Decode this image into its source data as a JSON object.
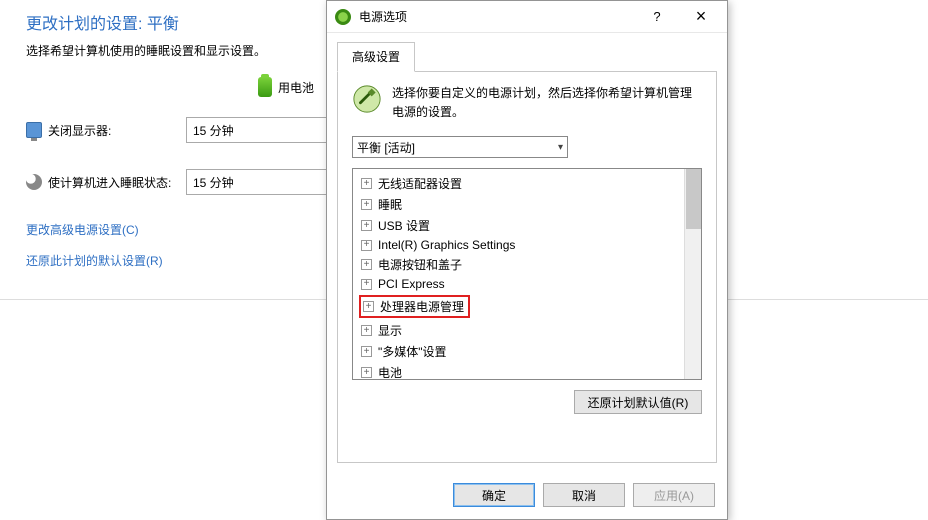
{
  "bg": {
    "title": "更改计划的设置: 平衡",
    "subtitle": "选择希望计算机使用的睡眠设置和显示设置。",
    "battery_label": "用电池",
    "display_off_label": "关闭显示器:",
    "display_off_value": "15 分钟",
    "sleep_label": "使计算机进入睡眠状态:",
    "sleep_value": "15 分钟",
    "link_advanced": "更改高级电源设置(C)",
    "link_restore": "还原此计划的默认设置(R)"
  },
  "dialog": {
    "title": "电源选项",
    "help_symbol": "?",
    "close_symbol": "×",
    "tab_label": "高级设置",
    "description": "选择你要自定义的电源计划，然后选择你希望计算机管理电源的设置。",
    "plan_selected": "平衡 [活动]",
    "tree": [
      {
        "label": "无线适配器设置",
        "highlight": false
      },
      {
        "label": "睡眠",
        "highlight": false
      },
      {
        "label": "USB 设置",
        "highlight": false
      },
      {
        "label": "Intel(R) Graphics Settings",
        "highlight": false
      },
      {
        "label": "电源按钮和盖子",
        "highlight": false
      },
      {
        "label": "PCI Express",
        "highlight": false
      },
      {
        "label": "处理器电源管理",
        "highlight": true
      },
      {
        "label": "显示",
        "highlight": false
      },
      {
        "label": "\"多媒体\"设置",
        "highlight": false
      },
      {
        "label": "电池",
        "highlight": false
      }
    ],
    "restore_defaults": "还原计划默认值(R)",
    "ok": "确定",
    "cancel": "取消",
    "apply": "应用(A)"
  }
}
